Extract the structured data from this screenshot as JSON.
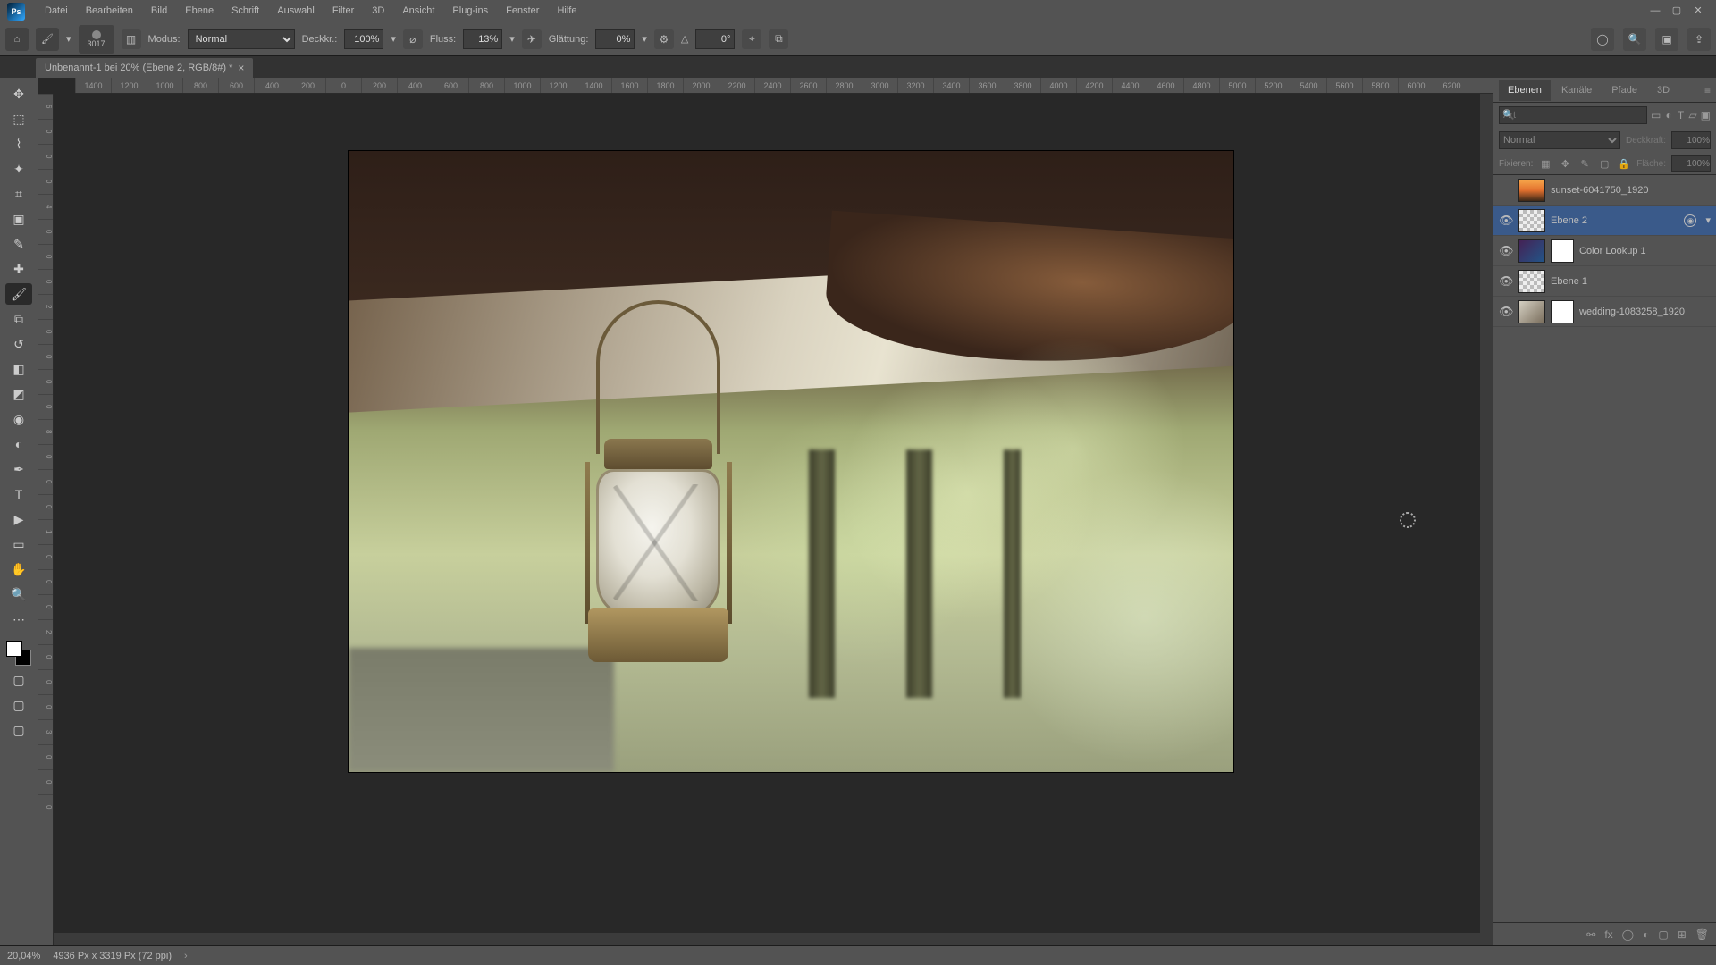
{
  "menu": {
    "items": [
      "Datei",
      "Bearbeiten",
      "Bild",
      "Ebene",
      "Schrift",
      "Auswahl",
      "Filter",
      "3D",
      "Ansicht",
      "Plug-ins",
      "Fenster",
      "Hilfe"
    ]
  },
  "window": {
    "min": "—",
    "max": "▢",
    "close": "✕"
  },
  "optbar": {
    "brush_size": "3017",
    "mode_label": "Modus:",
    "mode_value": "Normal",
    "opacity_label": "Deckkr.:",
    "opacity_value": "100%",
    "flow_label": "Fluss:",
    "flow_value": "13%",
    "smooth_label": "Glättung:",
    "smooth_value": "0%",
    "angle_icon": "△",
    "angle_value": "0°"
  },
  "doc_tab": {
    "title": "Unbenannt-1 bei 20% (Ebene 2, RGB/8#) *",
    "close": "×"
  },
  "ruler_h": [
    "1400",
    "1200",
    "1000",
    "800",
    "600",
    "400",
    "200",
    "0",
    "200",
    "400",
    "600",
    "800",
    "1000",
    "1200",
    "1400",
    "1600",
    "1800",
    "2000",
    "2200",
    "2400",
    "2600",
    "2800",
    "3000",
    "3200",
    "3400",
    "3600",
    "3800",
    "4000",
    "4200",
    "4400",
    "4600",
    "4800",
    "5000",
    "5200",
    "5400",
    "5600",
    "5800",
    "6000",
    "6200"
  ],
  "ruler_v": [
    "6",
    "0",
    "0",
    "0",
    "4",
    "0",
    "0",
    "0",
    "2",
    "0",
    "0",
    "0",
    "0",
    "8",
    "0",
    "0",
    "0",
    "1",
    "0",
    "0",
    "0",
    "2",
    "0",
    "0",
    "0",
    "3",
    "0",
    "0",
    "0"
  ],
  "panels": {
    "tabs": [
      "Ebenen",
      "Kanäle",
      "Pfade",
      "3D"
    ],
    "filter_placeholder": "Art",
    "blend_value": "Normal",
    "opacity_label": "Deckkraft:",
    "opacity_value": "100%",
    "lock_label": "Fixieren:",
    "fill_label": "Fläche:",
    "fill_value": "100%"
  },
  "layers": [
    {
      "name": "sunset-6041750_1920",
      "visible": false,
      "thumb": "sunset"
    },
    {
      "name": "Ebene 2",
      "visible": true,
      "thumb": "checker",
      "selected": true,
      "smartfilter": true
    },
    {
      "name": "Color Lookup 1",
      "visible": true,
      "thumb": "lut",
      "mask": true
    },
    {
      "name": "Ebene 1",
      "visible": true,
      "thumb": "checker"
    },
    {
      "name": "wedding-1083258_1920",
      "visible": true,
      "thumb": "wedding",
      "mask": true
    }
  ],
  "status": {
    "zoom": "20,04%",
    "docinfo": "4936 Px x 3319 Px (72 ppi)"
  },
  "tools": {
    "items": [
      {
        "name": "move-tool",
        "glyph": "✥"
      },
      {
        "name": "marquee-tool",
        "glyph": "⬚"
      },
      {
        "name": "lasso-tool",
        "glyph": "⌇"
      },
      {
        "name": "wand-tool",
        "glyph": "✦"
      },
      {
        "name": "crop-tool",
        "glyph": "⌗"
      },
      {
        "name": "frame-tool",
        "glyph": "▣"
      },
      {
        "name": "eyedropper-tool",
        "glyph": "✎"
      },
      {
        "name": "healing-tool",
        "glyph": "✚"
      },
      {
        "name": "brush-tool",
        "glyph": "🖌",
        "selected": true
      },
      {
        "name": "stamp-tool",
        "glyph": "⧉"
      },
      {
        "name": "history-brush-tool",
        "glyph": "↺"
      },
      {
        "name": "eraser-tool",
        "glyph": "◧"
      },
      {
        "name": "gradient-tool",
        "glyph": "◩"
      },
      {
        "name": "blur-tool",
        "glyph": "◉"
      },
      {
        "name": "dodge-tool",
        "glyph": "◐"
      },
      {
        "name": "pen-tool",
        "glyph": "✒"
      },
      {
        "name": "type-tool",
        "glyph": "T"
      },
      {
        "name": "path-select-tool",
        "glyph": "▶"
      },
      {
        "name": "shape-tool",
        "glyph": "▭"
      },
      {
        "name": "hand-tool",
        "glyph": "✋"
      },
      {
        "name": "zoom-tool",
        "glyph": "🔍"
      },
      {
        "name": "more-tool",
        "glyph": "⋯"
      }
    ]
  }
}
